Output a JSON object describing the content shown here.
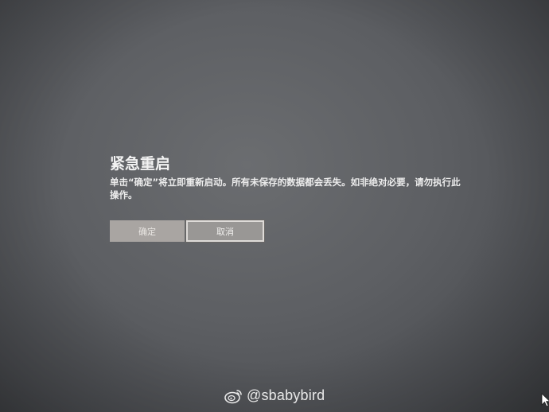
{
  "dialog": {
    "title": "紧急重启",
    "message": "单击“确定”将立即重新启动。所有未保存的数据都会丢失。如非绝对必要，请勿执行此操作。",
    "ok_label": "确定",
    "cancel_label": "取消"
  },
  "watermark": {
    "text": "@sbabybird",
    "icon": "weibo-icon"
  },
  "cursor": {
    "icon": "mouse-pointer-icon"
  },
  "colors": {
    "background": "#5d5f63",
    "ok_button": "#a9a5a2",
    "cancel_button": "#999795",
    "text": "#f2f2f2"
  }
}
